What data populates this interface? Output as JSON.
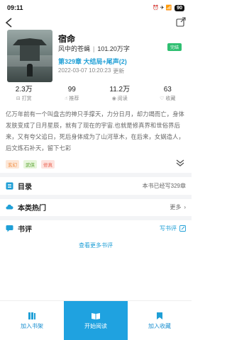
{
  "status_bar": {
    "time": "09:11",
    "indicators": "⏰ ✈ 📶",
    "battery": "90"
  },
  "book": {
    "title": "宿命",
    "author": "风中的苍蝇",
    "word_count": "101.20万字",
    "status": "完结",
    "latest_chapter": "第329章 大结局+尾声(2)",
    "updated_date": "2022-03-07 10:20:23",
    "updated_suffix": "更新",
    "cover_icons": {
      "back": "back-arrow-icon",
      "share": "share-icon"
    }
  },
  "stats": [
    {
      "value": "2.3万",
      "label": "打赏",
      "icon": "gift-icon"
    },
    {
      "value": "99",
      "label": "推荐",
      "icon": "thumbs-up-icon"
    },
    {
      "value": "11.2万",
      "label": "阅读",
      "icon": "eye-icon"
    },
    {
      "value": "63",
      "label": "收藏",
      "icon": "heart-icon"
    }
  ],
  "synopsis": "亿万年前有一个叫盘古的神只手撑天，力分日月，却力竭而亡，身体发肤变成了日月星辰，就有了现在的宇宙.也就是修真界和世俗界后来，又有夸父追日，死后身体成为了山河草木，在后来，女娲造人，后文炼石补天，留下七彩",
  "tags": [
    "玄幻",
    "武侠",
    "修真"
  ],
  "sections": {
    "catalog": {
      "title": "目录",
      "info": "本书已经写329章"
    },
    "popular": {
      "title": "本类热门",
      "action": "更多"
    },
    "reviews": {
      "title": "书评",
      "action": "写书评",
      "more": "查看更多书评"
    }
  },
  "bottom_bar": {
    "shelf": "加入书架",
    "read": "开始阅读",
    "favorite": "加入收藏"
  },
  "colors": {
    "accent": "#1fa2e0",
    "link": "#1f9fd6",
    "badge": "#2fbf71"
  }
}
